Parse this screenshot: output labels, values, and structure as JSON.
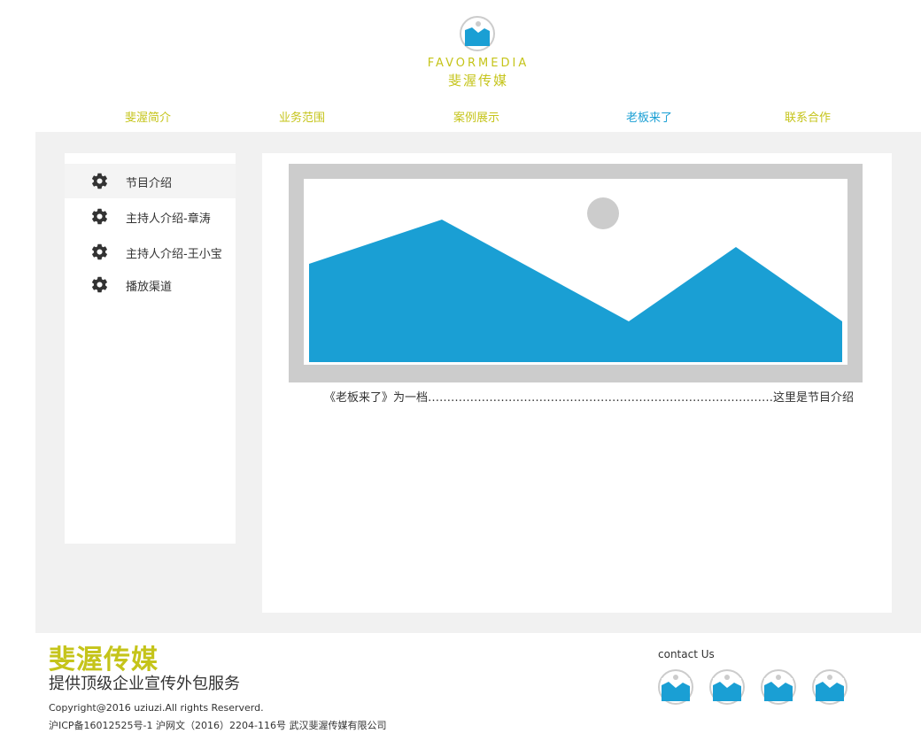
{
  "header": {
    "logo_icon": "image-placeholder-icon",
    "brand_en": "FAVORMEDIA",
    "brand_cn": "斐渥传媒"
  },
  "nav": {
    "items": [
      {
        "label": "斐渥简介",
        "active": false
      },
      {
        "label": "业务范围",
        "active": false
      },
      {
        "label": "案例展示",
        "active": false
      },
      {
        "label": "老板来了",
        "active": true
      },
      {
        "label": "联系合作",
        "active": false
      }
    ]
  },
  "sidebar": {
    "items": [
      {
        "label": "节目介绍",
        "icon": "gear-icon",
        "active": true
      },
      {
        "label": "主持人介绍-章涛",
        "icon": "gear-icon",
        "active": false
      },
      {
        "label": "主持人介绍-王小宝",
        "icon": "gear-icon",
        "active": false
      },
      {
        "label": "播放渠道",
        "icon": "gear-icon",
        "active": false
      }
    ]
  },
  "content": {
    "hero_icon": "image-placeholder",
    "description": "《老板来了》为一档………………………………………………………………………………这里是节目介绍"
  },
  "footer": {
    "title": "斐渥传媒",
    "slogan": "提供顶级企业宣传外包服务",
    "copyright": "Copyright@2016 uziuzi.All rights Reserverd.",
    "icp": "沪ICP备16012525号-1 沪网文（2016）2204-116号  武汉斐渥传媒有限公司",
    "contact_label": "contact Us",
    "social_icons": [
      "image-placeholder-icon",
      "image-placeholder-icon",
      "image-placeholder-icon",
      "image-placeholder-icon"
    ]
  },
  "colors": {
    "accent_olive": "#c5c41a",
    "accent_blue": "#1a9fd4",
    "band_grey": "#f1f1f1",
    "frame_grey": "#cccccc"
  }
}
